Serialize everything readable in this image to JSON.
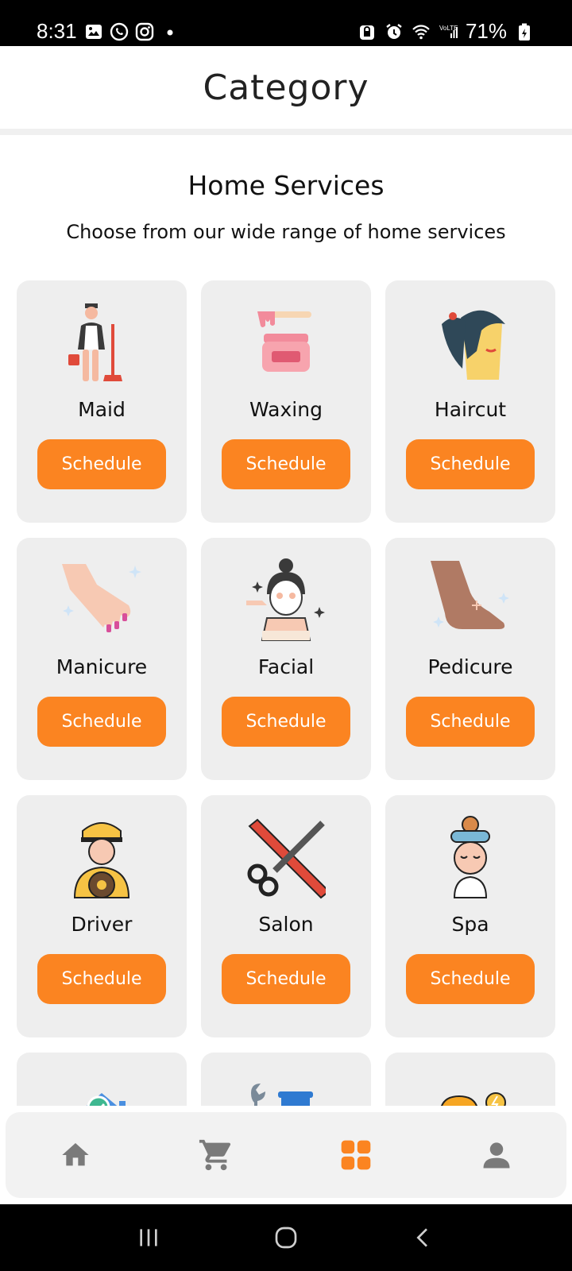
{
  "status_bar": {
    "time": "8:31",
    "battery": "71%"
  },
  "header": {
    "title": "Category"
  },
  "section": {
    "title": "Home Services",
    "subtitle": "Choose from our wide range of home services"
  },
  "services": [
    {
      "label": "Maid",
      "button": "Schedule",
      "icon": "maid-icon"
    },
    {
      "label": "Waxing",
      "button": "Schedule",
      "icon": "waxing-icon"
    },
    {
      "label": "Haircut",
      "button": "Schedule",
      "icon": "haircut-icon"
    },
    {
      "label": "Manicure",
      "button": "Schedule",
      "icon": "manicure-icon"
    },
    {
      "label": "Facial",
      "button": "Schedule",
      "icon": "facial-icon"
    },
    {
      "label": "Pedicure",
      "button": "Schedule",
      "icon": "pedicure-icon"
    },
    {
      "label": "Driver",
      "button": "Schedule",
      "icon": "driver-icon"
    },
    {
      "label": "Salon",
      "button": "Schedule",
      "icon": "salon-icon"
    },
    {
      "label": "Spa",
      "button": "Schedule",
      "icon": "spa-icon"
    },
    {
      "label": "",
      "button": "",
      "icon": "house-check-icon"
    },
    {
      "label": "",
      "button": "",
      "icon": "plumber-tools-icon"
    },
    {
      "label": "",
      "button": "",
      "icon": "electrician-icon"
    }
  ],
  "bottom_nav": [
    {
      "name": "home",
      "icon": "home-icon",
      "active": false
    },
    {
      "name": "cart",
      "icon": "cart-icon",
      "active": false
    },
    {
      "name": "categories",
      "icon": "grid-icon",
      "active": true
    },
    {
      "name": "profile",
      "icon": "profile-icon",
      "active": false
    }
  ],
  "colors": {
    "accent": "#fb8421",
    "card_bg": "#eeeeee",
    "nav_inactive": "#7a7a7a"
  }
}
